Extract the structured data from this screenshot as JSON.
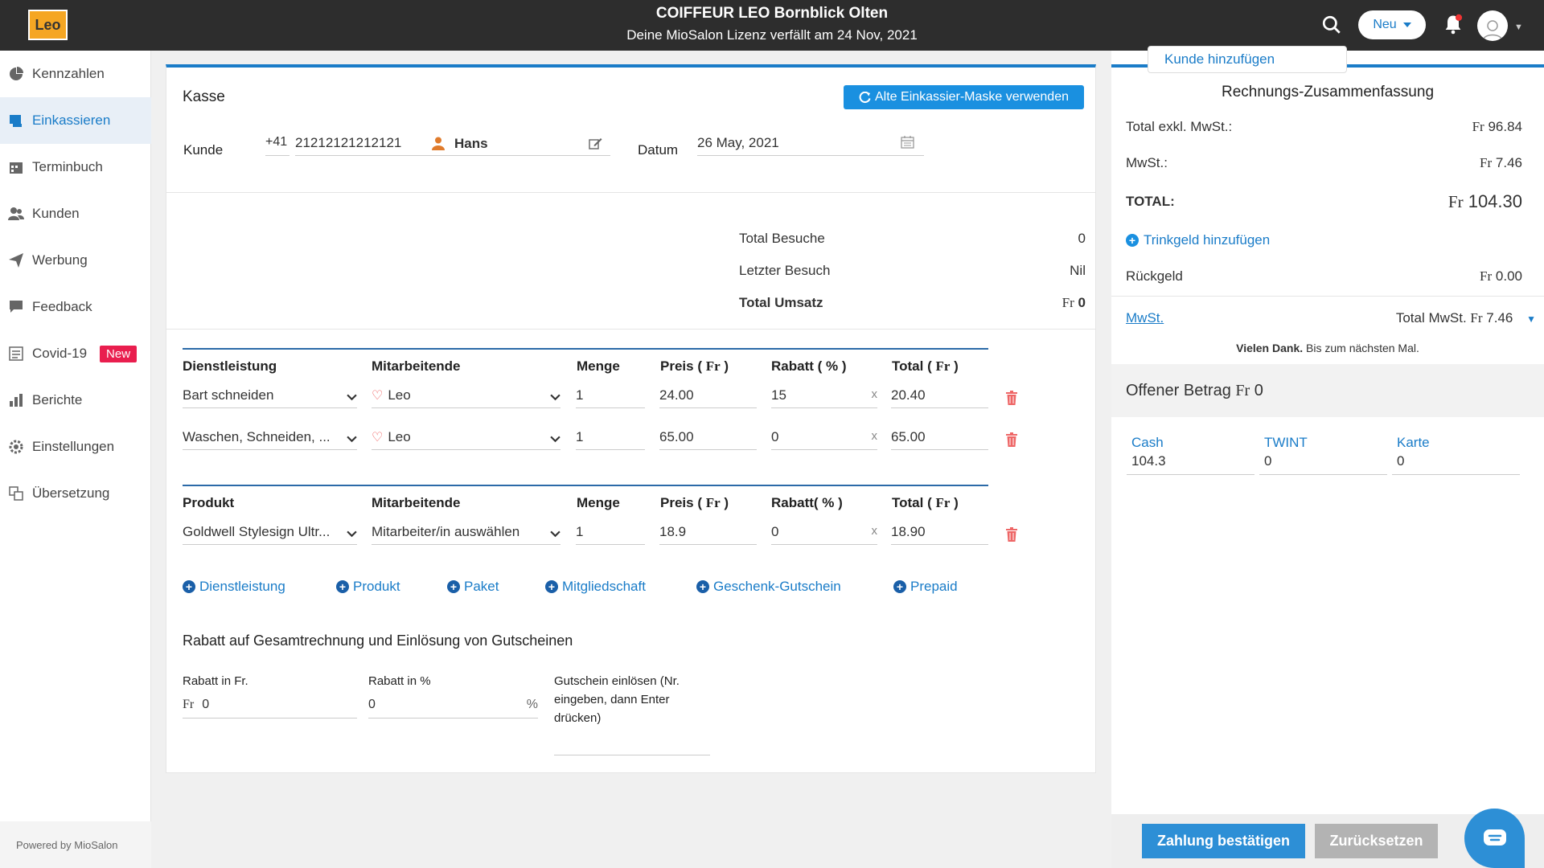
{
  "header": {
    "logo_text": "Leo",
    "title": "COIFFEUR LEO Bornblick Olten",
    "subtitle": "Deine MioSalon Lizenz verfällt am 24 Nov, 2021",
    "new_button": "Neu"
  },
  "sidebar": {
    "items": [
      {
        "label": "Kennzahlen",
        "icon": "pie-chart-icon"
      },
      {
        "label": "Einkassieren",
        "icon": "register-icon"
      },
      {
        "label": "Terminbuch",
        "icon": "calendar-icon"
      },
      {
        "label": "Kunden",
        "icon": "users-icon"
      },
      {
        "label": "Werbung",
        "icon": "send-icon"
      },
      {
        "label": "Feedback",
        "icon": "comment-icon"
      },
      {
        "label": "Covid-19",
        "icon": "list-icon",
        "badge": "New"
      },
      {
        "label": "Berichte",
        "icon": "bar-chart-icon"
      },
      {
        "label": "Einstellungen",
        "icon": "gear-icon"
      },
      {
        "label": "Übersetzung",
        "icon": "translate-icon"
      }
    ],
    "powered": "Powered by MioSalon"
  },
  "kasse": {
    "title": "Kasse",
    "alt_button": "Alte Einkassier-Maske verwenden",
    "kunde_label": "Kunde",
    "phone_prefix": "+41",
    "phone": "21212121212121",
    "customer_name": "Hans",
    "datum_label": "Datum",
    "date": "26 May, 2021"
  },
  "stats": {
    "total_besuche_label": "Total Besuche",
    "total_besuche": "0",
    "letzter_besuch_label": "Letzter Besuch",
    "letzter_besuch": "Nil",
    "total_umsatz_label": "Total Umsatz",
    "currency": "Fr",
    "total_umsatz": "0"
  },
  "services": {
    "headers": {
      "col1": "Dienstleistung",
      "col2": "Mitarbeitende",
      "col3": "Menge",
      "col4": "Preis",
      "col5": "Rabatt ( % )",
      "col6": "Total"
    },
    "cur": "Fr",
    "rows": [
      {
        "name": "Bart schneiden",
        "staff": "Leo",
        "qty": "1",
        "price": "24.00",
        "discount": "15",
        "total": "20.40"
      },
      {
        "name": "Waschen, Schneiden, ...",
        "staff": "Leo",
        "qty": "1",
        "price": "65.00",
        "discount": "0",
        "total": "65.00"
      }
    ]
  },
  "products": {
    "headers": {
      "col1": "Produkt",
      "col2": "Mitarbeitende",
      "col3": "Menge",
      "col4": "Preis",
      "col5": "Rabatt( % )",
      "col6": "Total"
    },
    "cur": "Fr",
    "rows": [
      {
        "name": "Goldwell Stylesign Ultr...",
        "staff": "Mitarbeiter/in auswählen",
        "qty": "1",
        "price": "18.9",
        "discount": "0",
        "total": "18.90"
      }
    ]
  },
  "add_links": [
    "Dienstleistung",
    "Produkt",
    "Paket",
    "Mitgliedschaft",
    "Geschenk-Gutschein",
    "Prepaid"
  ],
  "discount_section": {
    "title": "Rabatt auf Gesamtrechnung und Einlösung von Gutscheinen",
    "fr_label": "Rabatt in Fr.",
    "fr_prefix": "Fr",
    "fr_value": "0",
    "pct_label": "Rabatt in %",
    "pct_value": "0",
    "pct_suffix": "%",
    "voucher_label": "Gutschein einlösen (Nr. eingeben, dann Enter drücken)"
  },
  "summary": {
    "kunde_add": "Kunde hinzufügen",
    "title": "Rechnungs-Zusammenfassung",
    "total_excl_label": "Total exkl. MwSt.:",
    "total_excl": "96.84",
    "mwst_label": "MwSt.:",
    "mwst": "7.46",
    "total_label": "TOTAL:",
    "total": "104.30",
    "currency": "Fr",
    "tip_link": "Trinkgeld hinzufügen",
    "change_label": "Rückgeld",
    "change": "0.00",
    "mwst_link": "MwSt.",
    "total_mwst_label": "Total MwSt.",
    "total_mwst": "7.46",
    "thanks_bold": "Vielen Dank.",
    "thanks_rest": "Bis zum nächsten Mal.",
    "offen_label": "Offener Betrag",
    "offen_value": "0"
  },
  "payment": {
    "methods": [
      {
        "label": "Cash",
        "value": "104.3"
      },
      {
        "label": "TWINT",
        "value": "0"
      },
      {
        "label": "Karte",
        "value": "0"
      }
    ]
  },
  "footer": {
    "confirm": "Zahlung bestätigen",
    "reset": "Zurücksetzen"
  },
  "colors": {
    "accent": "#1a7cc8",
    "topbar": "#2d2d2d",
    "badge": "#e91e4e"
  }
}
